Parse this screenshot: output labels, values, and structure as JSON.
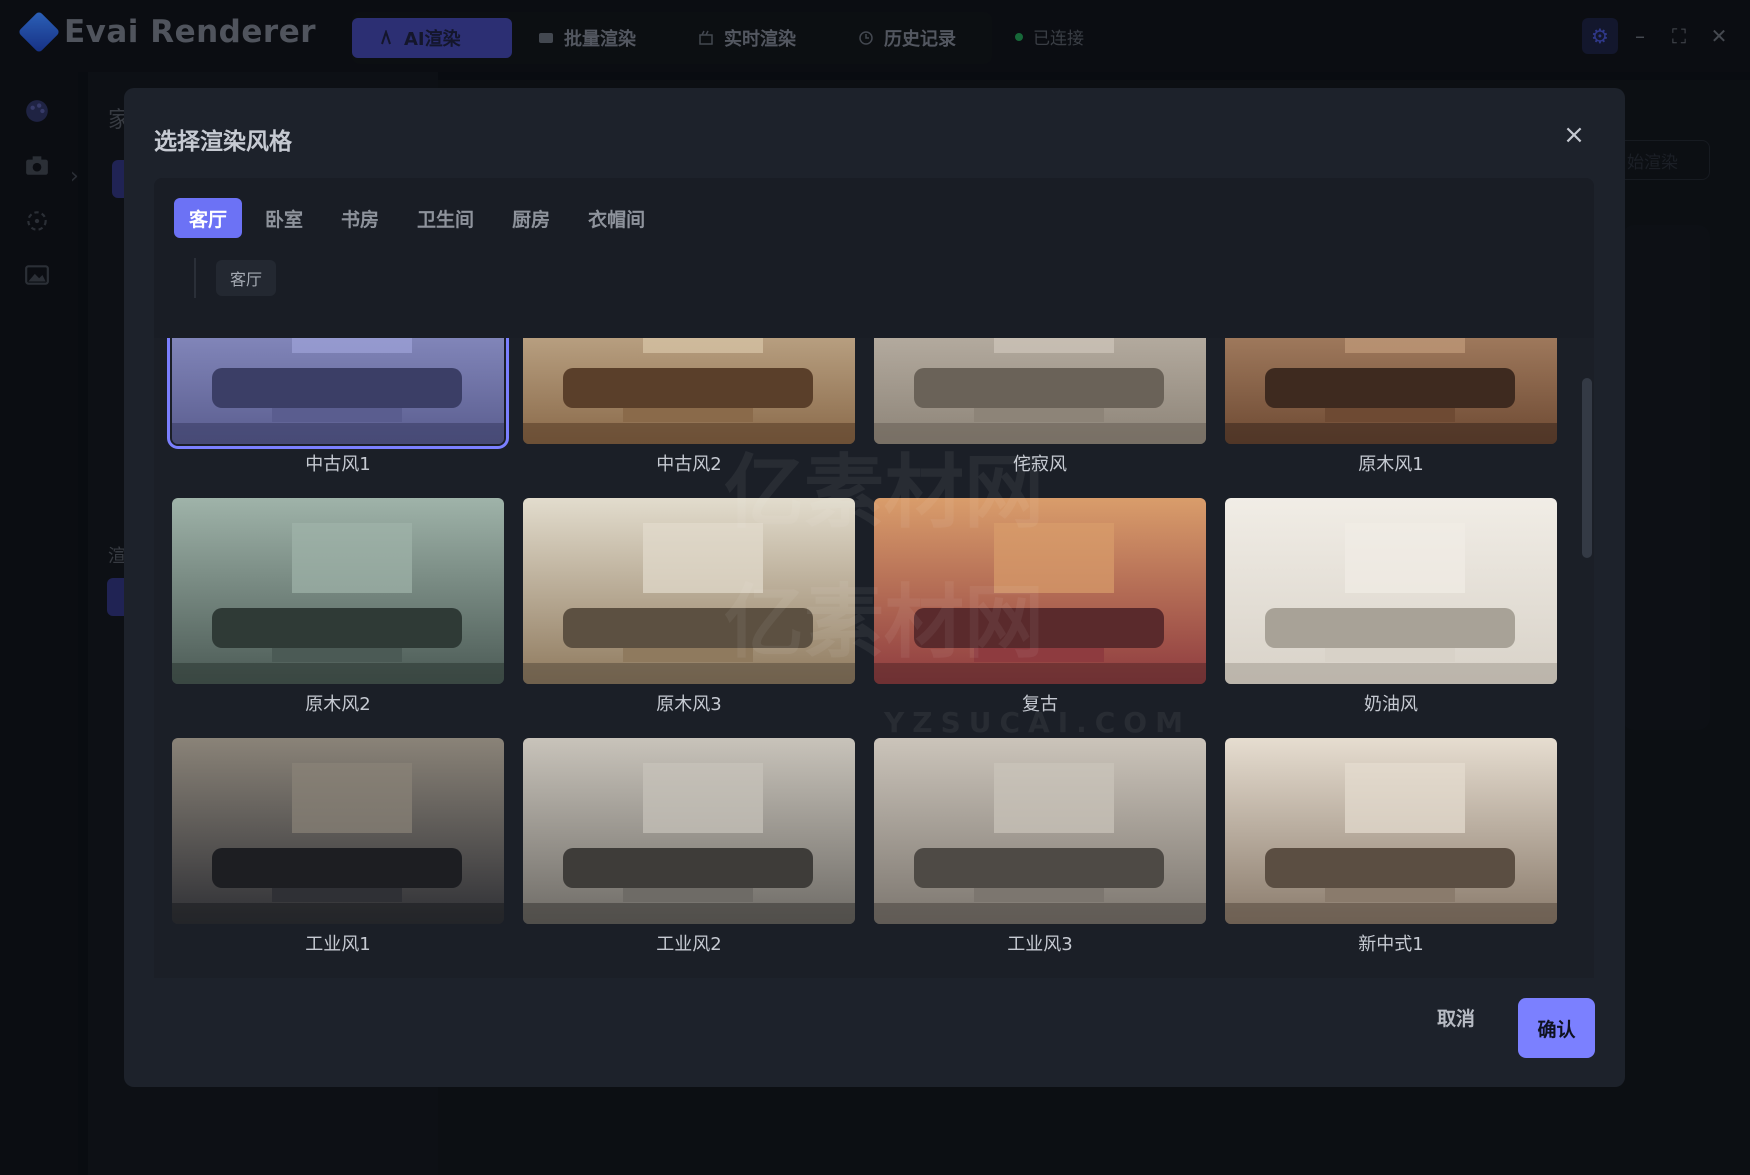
{
  "app": {
    "title": "Evai Renderer",
    "nav_tabs": [
      {
        "label": "AI渲染",
        "icon": "ai-icon"
      },
      {
        "label": "批量渲染",
        "icon": "batch-icon"
      },
      {
        "label": "实时渲染",
        "icon": "realtime-icon"
      },
      {
        "label": "历史记录",
        "icon": "history-icon"
      }
    ],
    "active_nav": "AI渲染",
    "status": "已连接"
  },
  "background": {
    "panel_heading_fragment": "家",
    "panel_label_fragment": "渲",
    "main_button_fragment": "始渲染"
  },
  "modal": {
    "title": "选择渲染风格",
    "categories": [
      "客厅",
      "卧室",
      "书房",
      "卫生间",
      "厨房",
      "衣帽间"
    ],
    "active_category": "客厅",
    "sub_tag": "客厅",
    "styles": [
      {
        "label": "中古风1",
        "selected": true
      },
      {
        "label": "中古风2",
        "selected": false
      },
      {
        "label": "侘寂风",
        "selected": false
      },
      {
        "label": "原木风1",
        "selected": false
      },
      {
        "label": "原木风2",
        "selected": false
      },
      {
        "label": "原木风3",
        "selected": false
      },
      {
        "label": "复古",
        "selected": false
      },
      {
        "label": "奶油风",
        "selected": false
      },
      {
        "label": "工业风1",
        "selected": false
      },
      {
        "label": "工业风2",
        "selected": false
      },
      {
        "label": "工业风3",
        "selected": false
      },
      {
        "label": "新中式1",
        "selected": false
      }
    ],
    "cancel_label": "取消",
    "confirm_label": "确认"
  },
  "watermark": {
    "text_cn": "亿素材网",
    "text_en": "YZSUCAI.COM"
  },
  "colors": {
    "accent": "#7b80ff",
    "active_nav_bg": "#3b3f9a",
    "modal_bg": "#1d222b",
    "connected_dot": "#1f8b4c"
  }
}
